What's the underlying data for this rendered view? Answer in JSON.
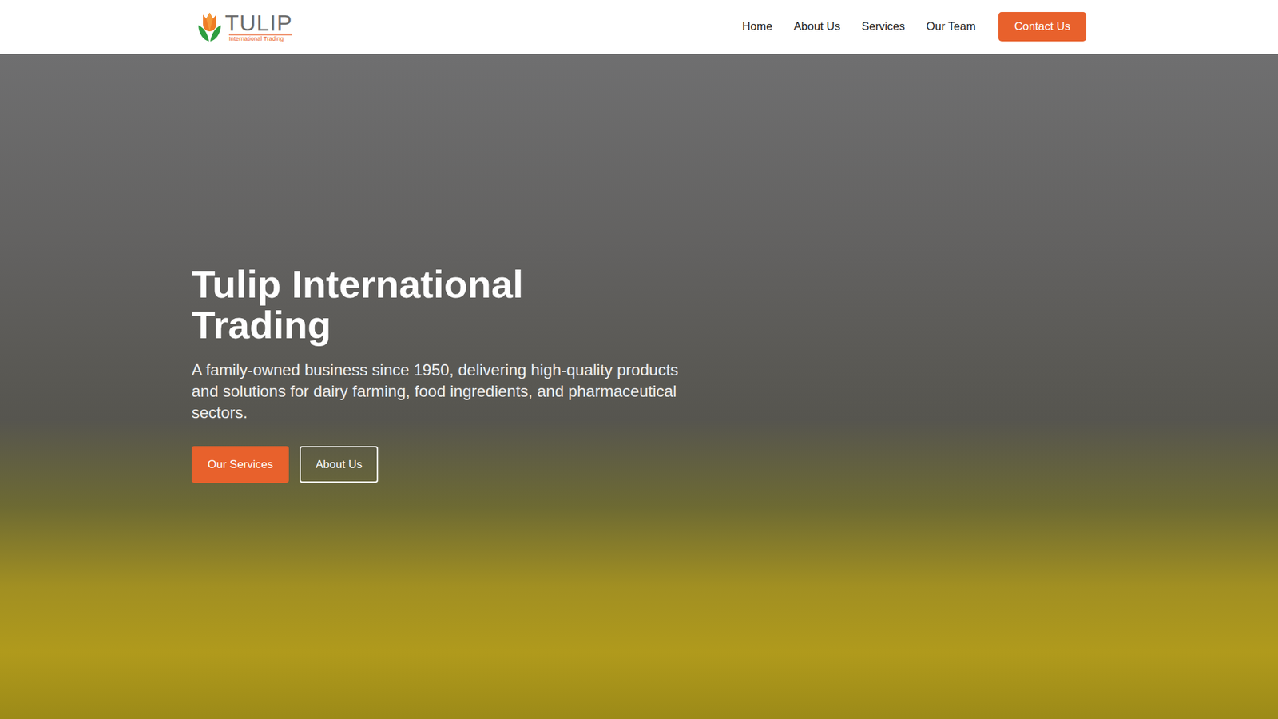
{
  "logo": {
    "name": "TULIP",
    "tagline": "International Trading"
  },
  "nav": {
    "items": [
      {
        "label": "Home"
      },
      {
        "label": "About Us"
      },
      {
        "label": "Services"
      },
      {
        "label": "Our Team"
      }
    ],
    "cta": "Contact Us"
  },
  "hero": {
    "title": "Tulip International Trading",
    "subtitle": "A family-owned business since 1950, delivering high-quality products and solutions for dairy farming, food ingredients, and pharmaceutical sectors.",
    "buttons": [
      {
        "label": "Our Services",
        "kind": "primary"
      },
      {
        "label": "About Us",
        "kind": "outline"
      }
    ]
  }
}
